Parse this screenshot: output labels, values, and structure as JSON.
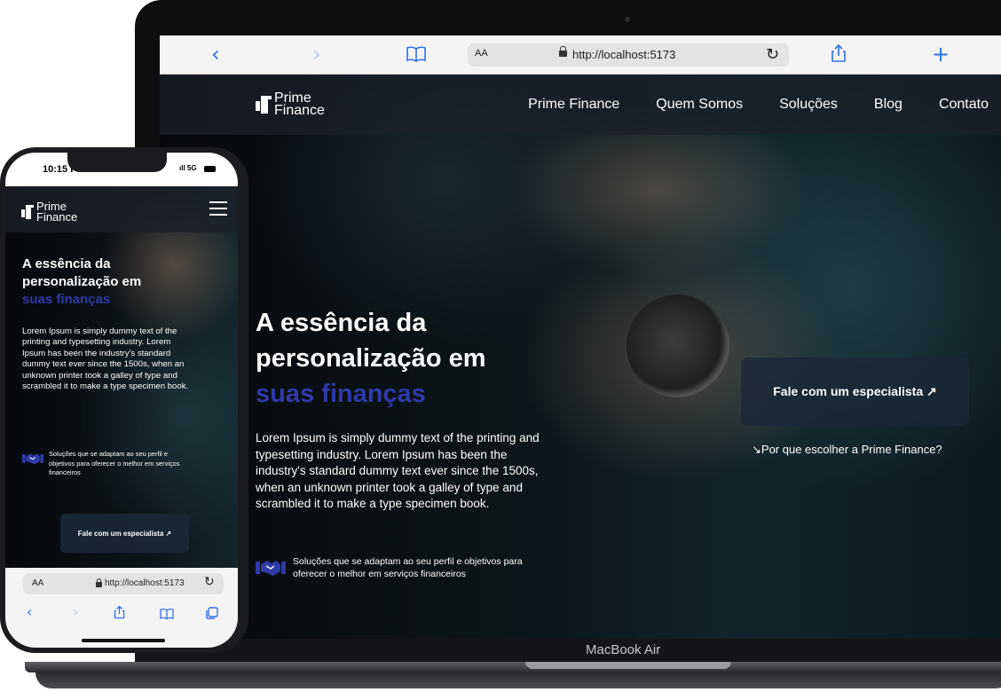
{
  "laptop": {
    "label": "MacBook Air",
    "browser": {
      "url": "http://localhost:5173",
      "text_size_label": "AA",
      "icons": {
        "back": "chevron-left-icon",
        "forward": "chevron-right-icon",
        "bookmarks": "book-icon",
        "lock": "lock-icon",
        "reload": "reload-icon",
        "share": "share-icon",
        "new_tab": "plus-icon"
      }
    },
    "site": {
      "logo": {
        "line1": "Prime",
        "line2": "Finance"
      },
      "nav": [
        "Prime Finance",
        "Quem Somos",
        "Soluções",
        "Blog",
        "Contato"
      ],
      "hero": {
        "title_line1": "A essência da",
        "title_line2": "personalização em",
        "title_accent": "suas finanças",
        "body": "Lorem Ipsum is simply dummy text of the printing and typesetting industry. Lorem Ipsum has been the industry's standard dummy text ever since the 1500s, when an unknown printer took a galley of type and scrambled it to make a type specimen book.",
        "feature": "Soluções que se adaptam ao seu perfil e objetivos para oferecer o melhor em serviços financeiros",
        "cta": "Fale com um especialista ↗",
        "why_link": "↘Por que escolher a Prime Finance?"
      }
    }
  },
  "phone": {
    "status": {
      "time": "10:15 PM",
      "network": "5G"
    },
    "browser": {
      "text_size_label": "AA",
      "url": "http://localhost:5173",
      "icons": {
        "back": "chevron-left-icon",
        "forward": "chevron-right-icon",
        "share": "share-icon",
        "bookmarks": "book-icon",
        "tabs": "tabs-icon",
        "reload": "reload-icon"
      }
    },
    "site": {
      "logo": {
        "line1": "Prime",
        "line2": "Finance"
      },
      "title_line1": "A essência da",
      "title_line2": "personalização em",
      "title_accent": "suas finanças",
      "body": "Lorem Ipsum is simply dummy text of the printing and typesetting industry. Lorem Ipsum has been the industry's standard dummy text ever since the 1500s, when an unknown printer took a galley of type and scrambled it to make a type specimen book.",
      "feature": "Soluções que se adaptam ao seu perfil e objetivos para oferecer o melhor em serviços financeiros",
      "cta": "Fale com um especialista ↗"
    }
  },
  "colors": {
    "accent": "#2e3aa8",
    "browser_blue": "#2f6fe4",
    "nav_bg": "#1c2028",
    "cta_bg": "#1b2837"
  }
}
